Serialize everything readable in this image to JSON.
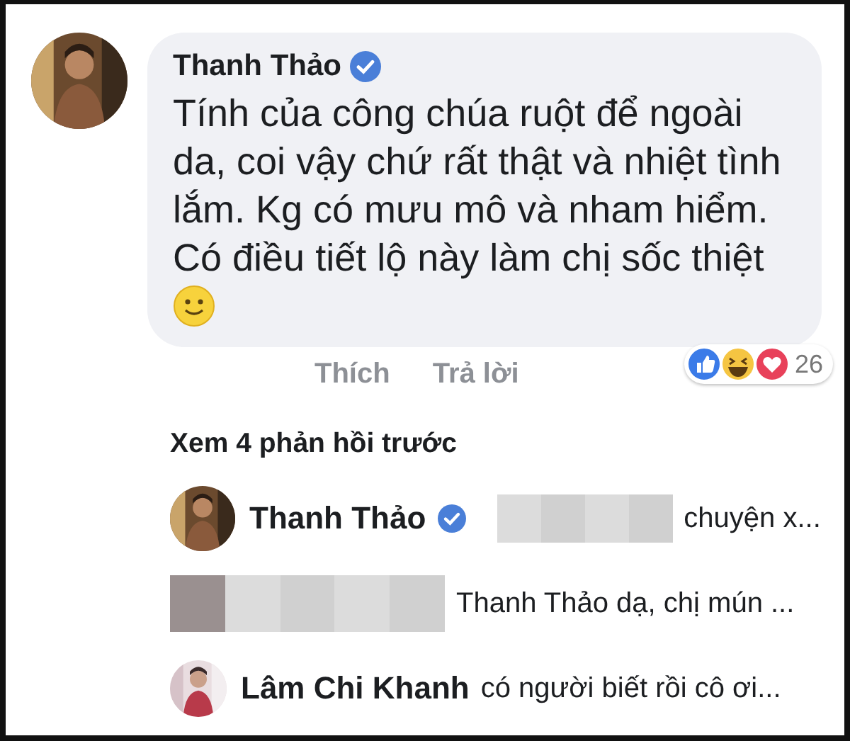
{
  "comment": {
    "author": "Thanh Thảo",
    "verified": true,
    "text": "Tính của công chúa ruột để ngoài da, coi vậy chứ rất thật và nhiệt tình lắm. Kg có mưu mô và nham hiểm. Có điều tiết lộ này làm chị sốc thiệt",
    "emoji": true
  },
  "actions": [
    "Thích",
    "Trả lời"
  ],
  "reactions": {
    "count": "26"
  },
  "view_previous": "Xem 4 phản hồi trước",
  "replies": [
    {
      "avatar": true,
      "author": "Thanh Thảo",
      "verified": true,
      "redacted": true,
      "text": "chuyện x..."
    },
    {
      "avatar": false,
      "redacted": true,
      "text": "Thanh Thảo dạ, chị mún ..."
    },
    {
      "avatar": true,
      "author": "Lâm Chi Khanh",
      "verified": false,
      "redacted": false,
      "text": "có người biết rồi cô ơi..."
    }
  ]
}
